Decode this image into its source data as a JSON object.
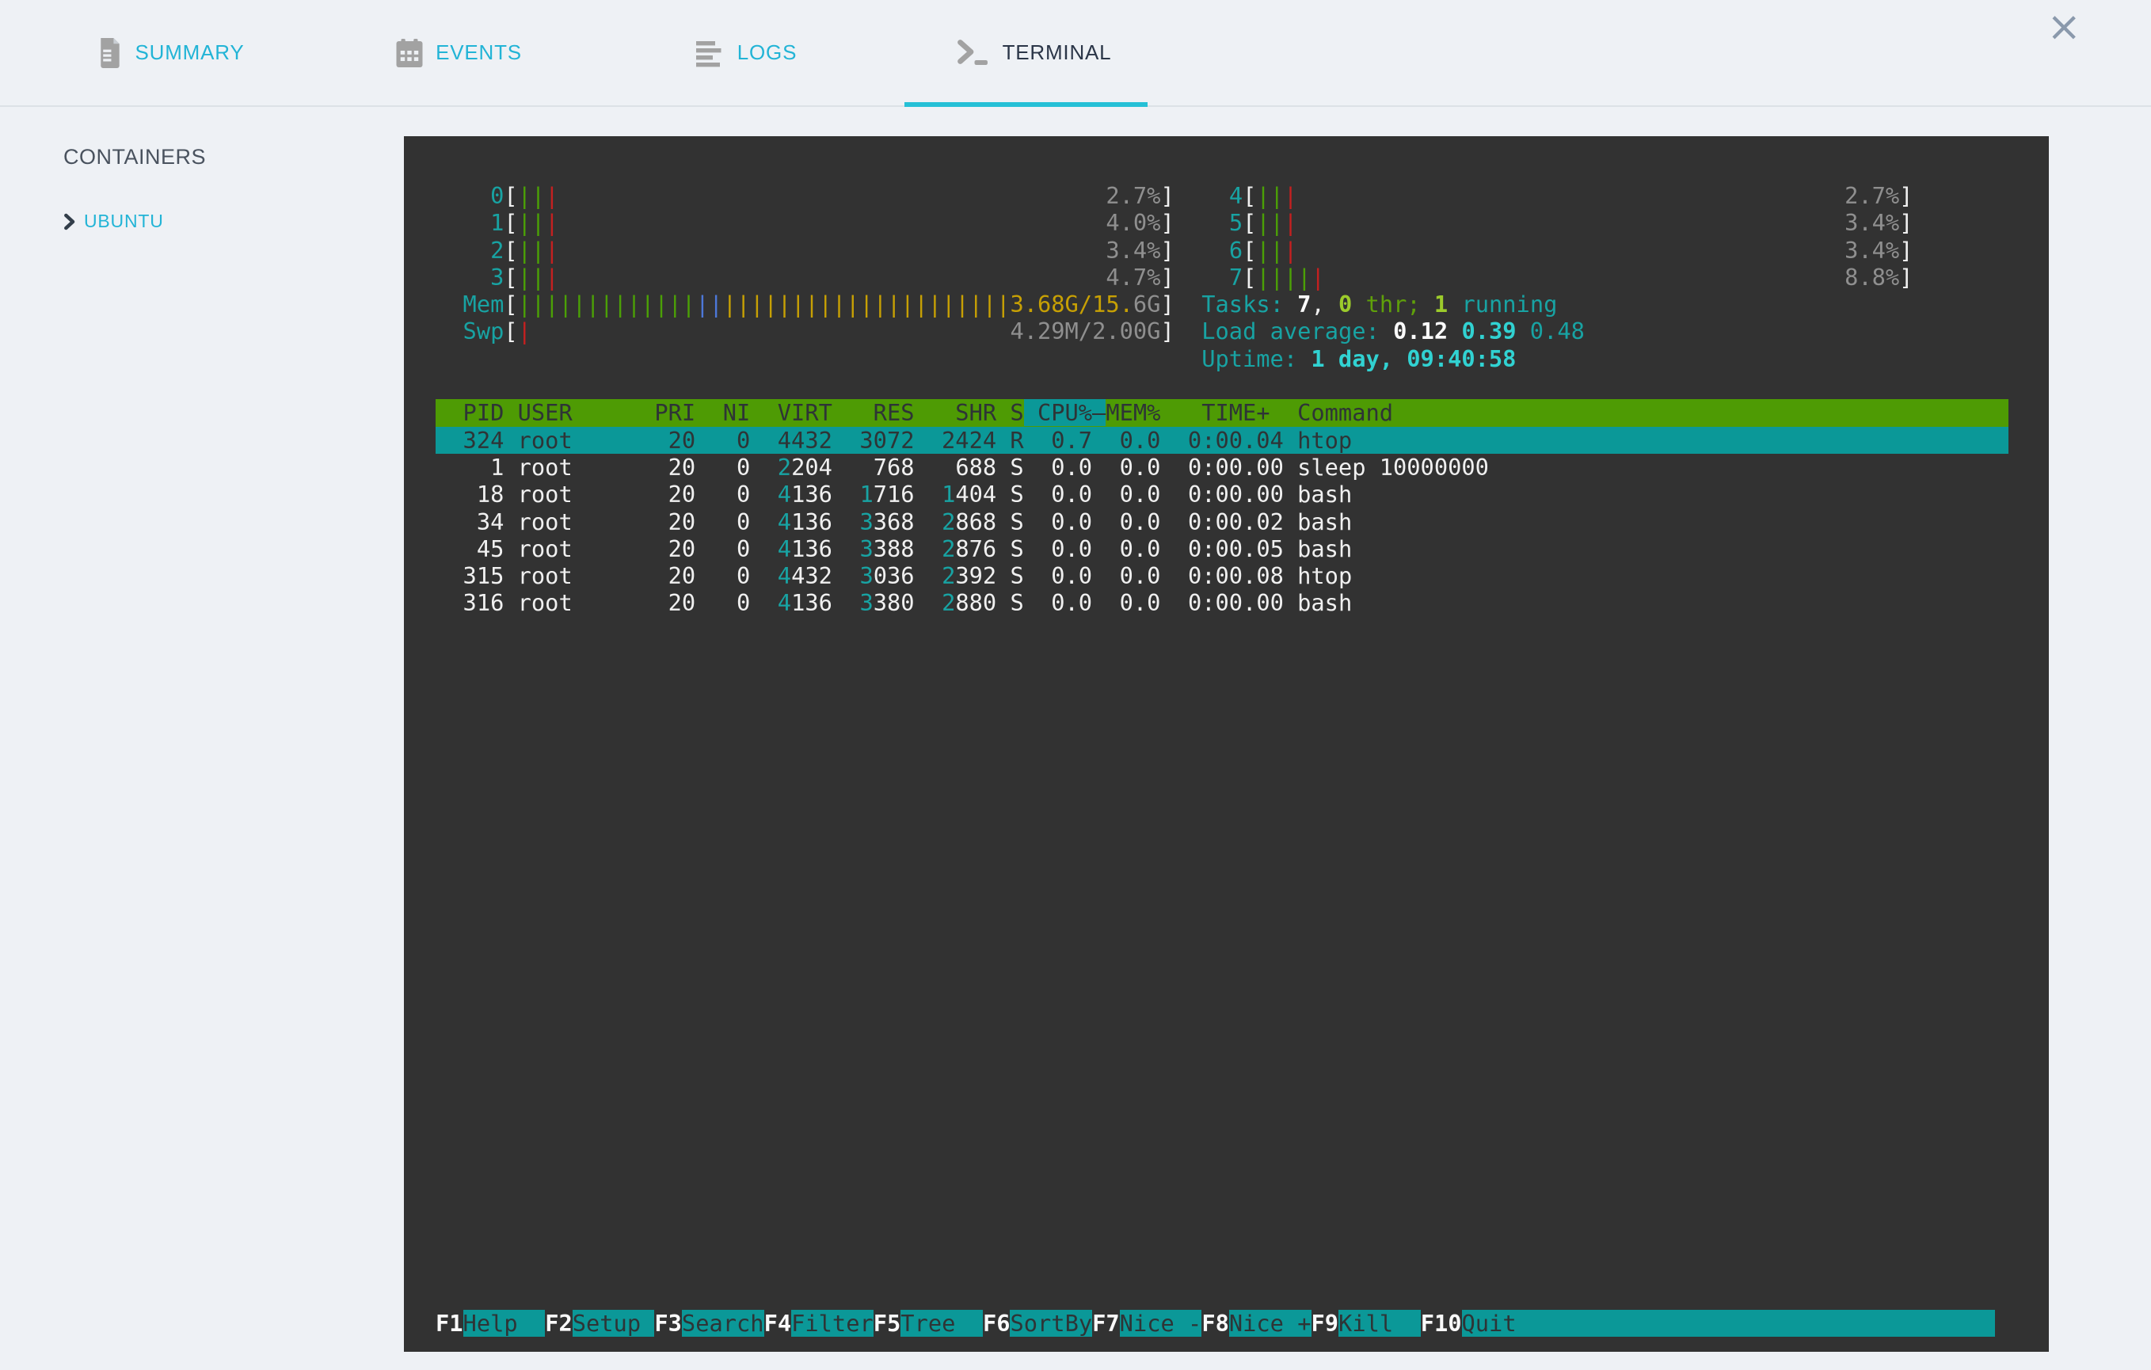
{
  "window": {
    "close_label": "×"
  },
  "tabs": [
    {
      "label": "SUMMARY",
      "icon": "document-icon",
      "active": false
    },
    {
      "label": "EVENTS",
      "icon": "calendar-icon",
      "active": false
    },
    {
      "label": "LOGS",
      "icon": "log-lines-icon",
      "active": false
    },
    {
      "label": "TERMINAL",
      "icon": "terminal-prompt-icon",
      "active": true
    }
  ],
  "sidebar": {
    "title": "CONTAINERS",
    "items": [
      {
        "label": "UBUNTU"
      }
    ]
  },
  "terminal": {
    "colors": {
      "background": "#323232",
      "teal_label": "#18a3a3",
      "cyan_bright": "#31d2d2",
      "white": "#f0f0f0",
      "gray": "#8f8f8f",
      "green_bar": "#4ba006",
      "lime_bold": "#9ccb2b",
      "olive": "#5fa00a",
      "red_bar": "#c42020",
      "blue_bar": "#4d78d8",
      "yellow": "#c7a004",
      "header_bg": "#4e9b04",
      "highlight_bg": "#0b9898",
      "dark_text": "#2e3436",
      "tab_accent": "#25c0d6"
    },
    "lines": [
      {
        "n": "cpu-meter-row-0-4",
        "s": [
          [
            "    ",
            "w"
          ],
          [
            "0",
            "c"
          ],
          [
            "[",
            "w"
          ],
          [
            "||",
            "g"
          ],
          [
            "|",
            "r"
          ],
          [
            "                                        ",
            "w"
          ],
          [
            "2.7%",
            "d"
          ],
          [
            "]",
            "w"
          ],
          [
            "    ",
            "w"
          ],
          [
            "4",
            "c"
          ],
          [
            "[",
            "w"
          ],
          [
            "||",
            "g"
          ],
          [
            "|",
            "r"
          ],
          [
            "                                        ",
            "w"
          ],
          [
            "2.7%",
            "d"
          ],
          [
            "]",
            "w"
          ]
        ]
      },
      {
        "n": "cpu-meter-row-1-5",
        "s": [
          [
            "    ",
            "w"
          ],
          [
            "1",
            "c"
          ],
          [
            "[",
            "w"
          ],
          [
            "||",
            "g"
          ],
          [
            "|",
            "r"
          ],
          [
            "                                        ",
            "w"
          ],
          [
            "4.0%",
            "d"
          ],
          [
            "]",
            "w"
          ],
          [
            "    ",
            "w"
          ],
          [
            "5",
            "c"
          ],
          [
            "[",
            "w"
          ],
          [
            "||",
            "g"
          ],
          [
            "|",
            "r"
          ],
          [
            "                                        ",
            "w"
          ],
          [
            "3.4%",
            "d"
          ],
          [
            "]",
            "w"
          ]
        ]
      },
      {
        "n": "cpu-meter-row-2-6",
        "s": [
          [
            "    ",
            "w"
          ],
          [
            "2",
            "c"
          ],
          [
            "[",
            "w"
          ],
          [
            "||",
            "g"
          ],
          [
            "|",
            "r"
          ],
          [
            "                                        ",
            "w"
          ],
          [
            "3.4%",
            "d"
          ],
          [
            "]",
            "w"
          ],
          [
            "    ",
            "w"
          ],
          [
            "6",
            "c"
          ],
          [
            "[",
            "w"
          ],
          [
            "||",
            "g"
          ],
          [
            "|",
            "r"
          ],
          [
            "                                        ",
            "w"
          ],
          [
            "3.4%",
            "d"
          ],
          [
            "]",
            "w"
          ]
        ]
      },
      {
        "n": "cpu-meter-row-3-7",
        "s": [
          [
            "    ",
            "w"
          ],
          [
            "3",
            "c"
          ],
          [
            "[",
            "w"
          ],
          [
            "||",
            "g"
          ],
          [
            "|",
            "r"
          ],
          [
            "                                        ",
            "w"
          ],
          [
            "4.7%",
            "d"
          ],
          [
            "]",
            "w"
          ],
          [
            "    ",
            "w"
          ],
          [
            "7",
            "c"
          ],
          [
            "[",
            "w"
          ],
          [
            "||||",
            "g"
          ],
          [
            "|",
            "r"
          ],
          [
            "                                      ",
            "w"
          ],
          [
            "8.8%",
            "d"
          ],
          [
            "]",
            "w"
          ]
        ]
      },
      {
        "n": "mem-meter-tasks-row",
        "s": [
          [
            "  ",
            "w"
          ],
          [
            "Mem",
            "c"
          ],
          [
            "[",
            "w"
          ],
          [
            "|||||||||||||",
            "g"
          ],
          [
            "||",
            "b"
          ],
          [
            "|||||||||||||||||||||",
            "y"
          ],
          [
            "3.68G/15.",
            "y"
          ],
          [
            "6G",
            "d"
          ],
          [
            "]",
            "w"
          ],
          [
            "  ",
            "w"
          ],
          [
            "Tasks: ",
            "c"
          ],
          [
            "7",
            "W"
          ],
          [
            ", ",
            "w"
          ],
          [
            "0",
            "G"
          ],
          [
            " thr; ",
            "o"
          ],
          [
            "1",
            "G"
          ],
          [
            " running",
            "c"
          ]
        ]
      },
      {
        "n": "swp-meter-load-row",
        "s": [
          [
            "  ",
            "w"
          ],
          [
            "Swp",
            "c"
          ],
          [
            "[",
            "w"
          ],
          [
            "|",
            "r"
          ],
          [
            "                                   ",
            "w"
          ],
          [
            "4.29M/2.00G",
            "d"
          ],
          [
            "]",
            "w"
          ],
          [
            "  ",
            "w"
          ],
          [
            "Load average: ",
            "c"
          ],
          [
            "0.12 ",
            "W"
          ],
          [
            "0.39 ",
            "C"
          ],
          [
            "0.48",
            "c"
          ]
        ]
      },
      {
        "n": "uptime-row",
        "s": [
          [
            "                                                        ",
            "w"
          ],
          [
            "Uptime: ",
            "c"
          ],
          [
            "1 day, ",
            "C"
          ],
          [
            "09:40:58",
            "C"
          ]
        ]
      },
      {
        "n": "blank-row",
        "s": [
          [
            "",
            "w"
          ]
        ]
      },
      {
        "n": "process-table-header",
        "bg": "hdr",
        "s": [
          [
            "  PID USER      PRI  NI  VIRT   RES   SHR S",
            "hg"
          ],
          [
            " CPU%–",
            "hs"
          ],
          [
            "MEM%   TIME+  Command",
            "hg"
          ]
        ]
      },
      {
        "n": "process-row-324-selected",
        "bg": "sel",
        "s": [
          [
            "  324 root       20   0  4432  3072  2424 R  0.7  0.0  0:00.04 htop",
            "k"
          ]
        ]
      },
      {
        "n": "process-row-1",
        "s": [
          [
            "    1 root       20   0  ",
            "w"
          ],
          [
            "2",
            "c"
          ],
          [
            "204   768   688 S  0.0  0.0  0:00.00 sleep 10000000",
            "w"
          ]
        ]
      },
      {
        "n": "process-row-18",
        "s": [
          [
            "   18 root       20   0  ",
            "w"
          ],
          [
            "4",
            "c"
          ],
          [
            "136  ",
            "w"
          ],
          [
            "1",
            "c"
          ],
          [
            "716  ",
            "w"
          ],
          [
            "1",
            "c"
          ],
          [
            "404 S  0.0  0.0  0:00.00 bash",
            "w"
          ]
        ]
      },
      {
        "n": "process-row-34",
        "s": [
          [
            "   34 root       20   0  ",
            "w"
          ],
          [
            "4",
            "c"
          ],
          [
            "136  ",
            "w"
          ],
          [
            "3",
            "c"
          ],
          [
            "368  ",
            "w"
          ],
          [
            "2",
            "c"
          ],
          [
            "868 S  0.0  0.0  0:00.02 bash",
            "w"
          ]
        ]
      },
      {
        "n": "process-row-45",
        "s": [
          [
            "   45 root       20   0  ",
            "w"
          ],
          [
            "4",
            "c"
          ],
          [
            "136  ",
            "w"
          ],
          [
            "3",
            "c"
          ],
          [
            "388  ",
            "w"
          ],
          [
            "2",
            "c"
          ],
          [
            "876 S  0.0  0.0  0:00.05 bash",
            "w"
          ]
        ]
      },
      {
        "n": "process-row-315",
        "s": [
          [
            "  315 root       20   0  ",
            "w"
          ],
          [
            "4",
            "c"
          ],
          [
            "432  ",
            "w"
          ],
          [
            "3",
            "c"
          ],
          [
            "036  ",
            "w"
          ],
          [
            "2",
            "c"
          ],
          [
            "392 S  0.0  0.0  0:00.08 htop",
            "w"
          ]
        ]
      },
      {
        "n": "process-row-316",
        "s": [
          [
            "  316 root       20   0  ",
            "w"
          ],
          [
            "4",
            "c"
          ],
          [
            "136  ",
            "w"
          ],
          [
            "3",
            "c"
          ],
          [
            "380  ",
            "w"
          ],
          [
            "2",
            "c"
          ],
          [
            "880 S  0.0  0.0  0:00.00 bash",
            "w"
          ]
        ]
      }
    ],
    "fnbar": {
      "items": [
        {
          "key": "F1",
          "label": "Help  "
        },
        {
          "key": "F2",
          "label": "Setup "
        },
        {
          "key": "F3",
          "label": "Search"
        },
        {
          "key": "F4",
          "label": "Filter"
        },
        {
          "key": "F5",
          "label": "Tree  "
        },
        {
          "key": "F6",
          "label": "SortBy"
        },
        {
          "key": "F7",
          "label": "Nice -"
        },
        {
          "key": "F8",
          "label": "Nice +"
        },
        {
          "key": "F9",
          "label": "Kill  "
        },
        {
          "key": "F10",
          "label": "Quit"
        }
      ],
      "fill": "                                   "
    }
  }
}
